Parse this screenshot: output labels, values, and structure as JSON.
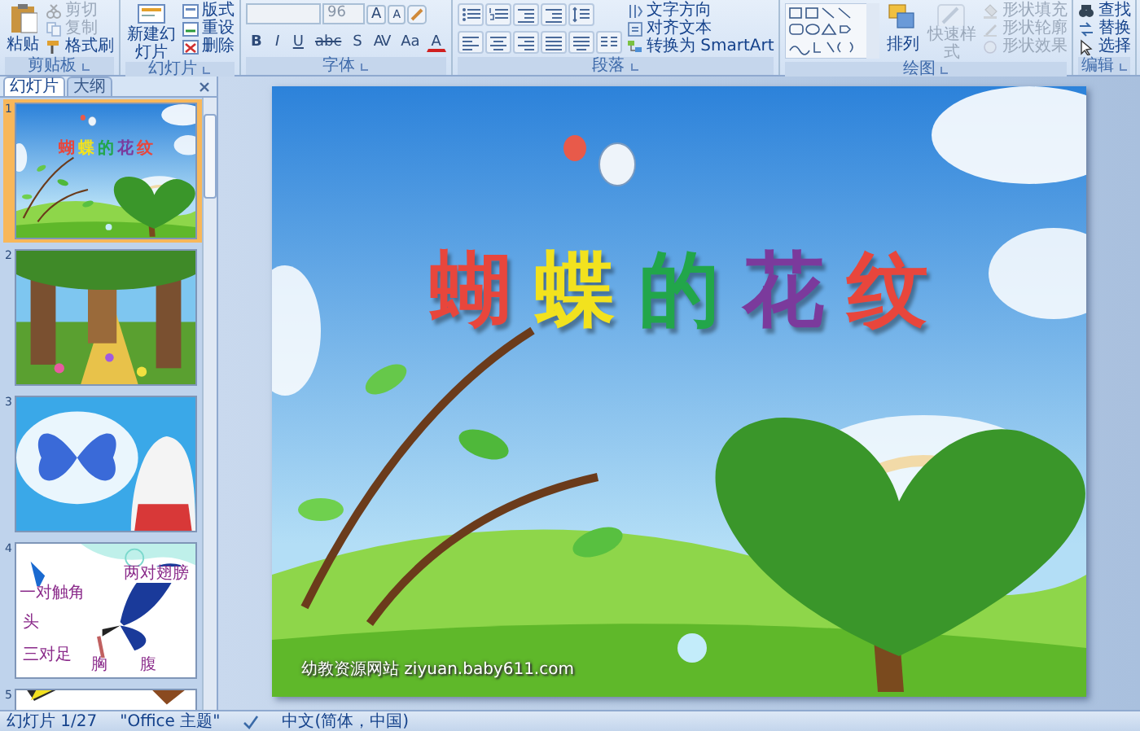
{
  "ribbon": {
    "groups": [
      {
        "kind": "clipboard",
        "label": "剪贴板",
        "big": [
          {
            "label": "粘贴",
            "disabled": false
          }
        ],
        "small": [
          {
            "label": "剪切",
            "disabled": true
          },
          {
            "label": "复制",
            "disabled": true
          },
          {
            "label": "格式刷",
            "disabled": false
          }
        ]
      },
      {
        "kind": "slides",
        "label": "幻灯片",
        "big": [
          {
            "label": "新建幻灯片",
            "disabled": false
          }
        ],
        "small": [
          {
            "label": "版式",
            "disabled": false
          },
          {
            "label": "重设",
            "disabled": false
          },
          {
            "label": "删除",
            "disabled": false
          }
        ]
      },
      {
        "kind": "font",
        "label": "字体",
        "font_size": "96",
        "top_buttons": [
          "A",
          "A"
        ],
        "bottom_buttons": [
          "B",
          "I",
          "U",
          "abc",
          "S",
          "AV",
          "Aa",
          "A"
        ]
      },
      {
        "kind": "paragraph",
        "label": "段落",
        "small": [
          {
            "label": "文字方向",
            "disabled": false
          },
          {
            "label": "对齐文本",
            "disabled": false
          },
          {
            "label": "转换为 SmartArt",
            "disabled": false
          }
        ]
      },
      {
        "kind": "drawing",
        "label": "绘图",
        "big": [
          {
            "label": "排列",
            "disabled": false
          },
          {
            "label": "快速样式",
            "disabled": true
          }
        ],
        "small": [
          {
            "label": "形状填充",
            "disabled": true
          },
          {
            "label": "形状轮廓",
            "disabled": true
          },
          {
            "label": "形状效果",
            "disabled": true
          }
        ]
      },
      {
        "kind": "editing",
        "label": "编辑",
        "small": [
          {
            "label": "查找",
            "disabled": false
          },
          {
            "label": "替换",
            "disabled": false
          },
          {
            "label": "选择",
            "disabled": false
          }
        ]
      }
    ]
  },
  "pane": {
    "tabs": [
      {
        "label": "幻灯片",
        "selected": true
      },
      {
        "label": "大纲",
        "selected": false
      }
    ],
    "thumbnails": [
      {
        "number": "1",
        "selected": true,
        "kind": "title",
        "title_chars": [
          {
            "text": "蝴",
            "color": "#e8463c"
          },
          {
            "text": "蝶",
            "color": "#f2e21e"
          },
          {
            "text": "的",
            "color": "#22a64a"
          },
          {
            "text": "花",
            "color": "#7b3a9c"
          },
          {
            "text": "纹",
            "color": "#e8463c"
          }
        ]
      },
      {
        "number": "2",
        "selected": false,
        "kind": "picture"
      },
      {
        "number": "3",
        "selected": false,
        "kind": "picture"
      },
      {
        "number": "4",
        "selected": false,
        "kind": "diagram",
        "labels": [
          "一对触角",
          "两对翅膀",
          "头",
          "三对足",
          "胸",
          "腹"
        ]
      },
      {
        "number": "5",
        "selected": false,
        "kind": "picture"
      }
    ]
  },
  "slide": {
    "title_chars": [
      {
        "text": "蝴",
        "color": "#e8463c"
      },
      {
        "text": "蝶",
        "color": "#f2e21e"
      },
      {
        "text": "的",
        "color": "#22a64a"
      },
      {
        "text": "花",
        "color": "#7b3a9c"
      },
      {
        "text": "纹",
        "color": "#e8463c"
      }
    ],
    "caption": "幼教资源网站 ziyuan.baby611.com"
  },
  "status_bar": {
    "slide": "幻灯片 1/27",
    "theme": "\"Office 主题\"",
    "language": "中文(简体，中国)"
  }
}
